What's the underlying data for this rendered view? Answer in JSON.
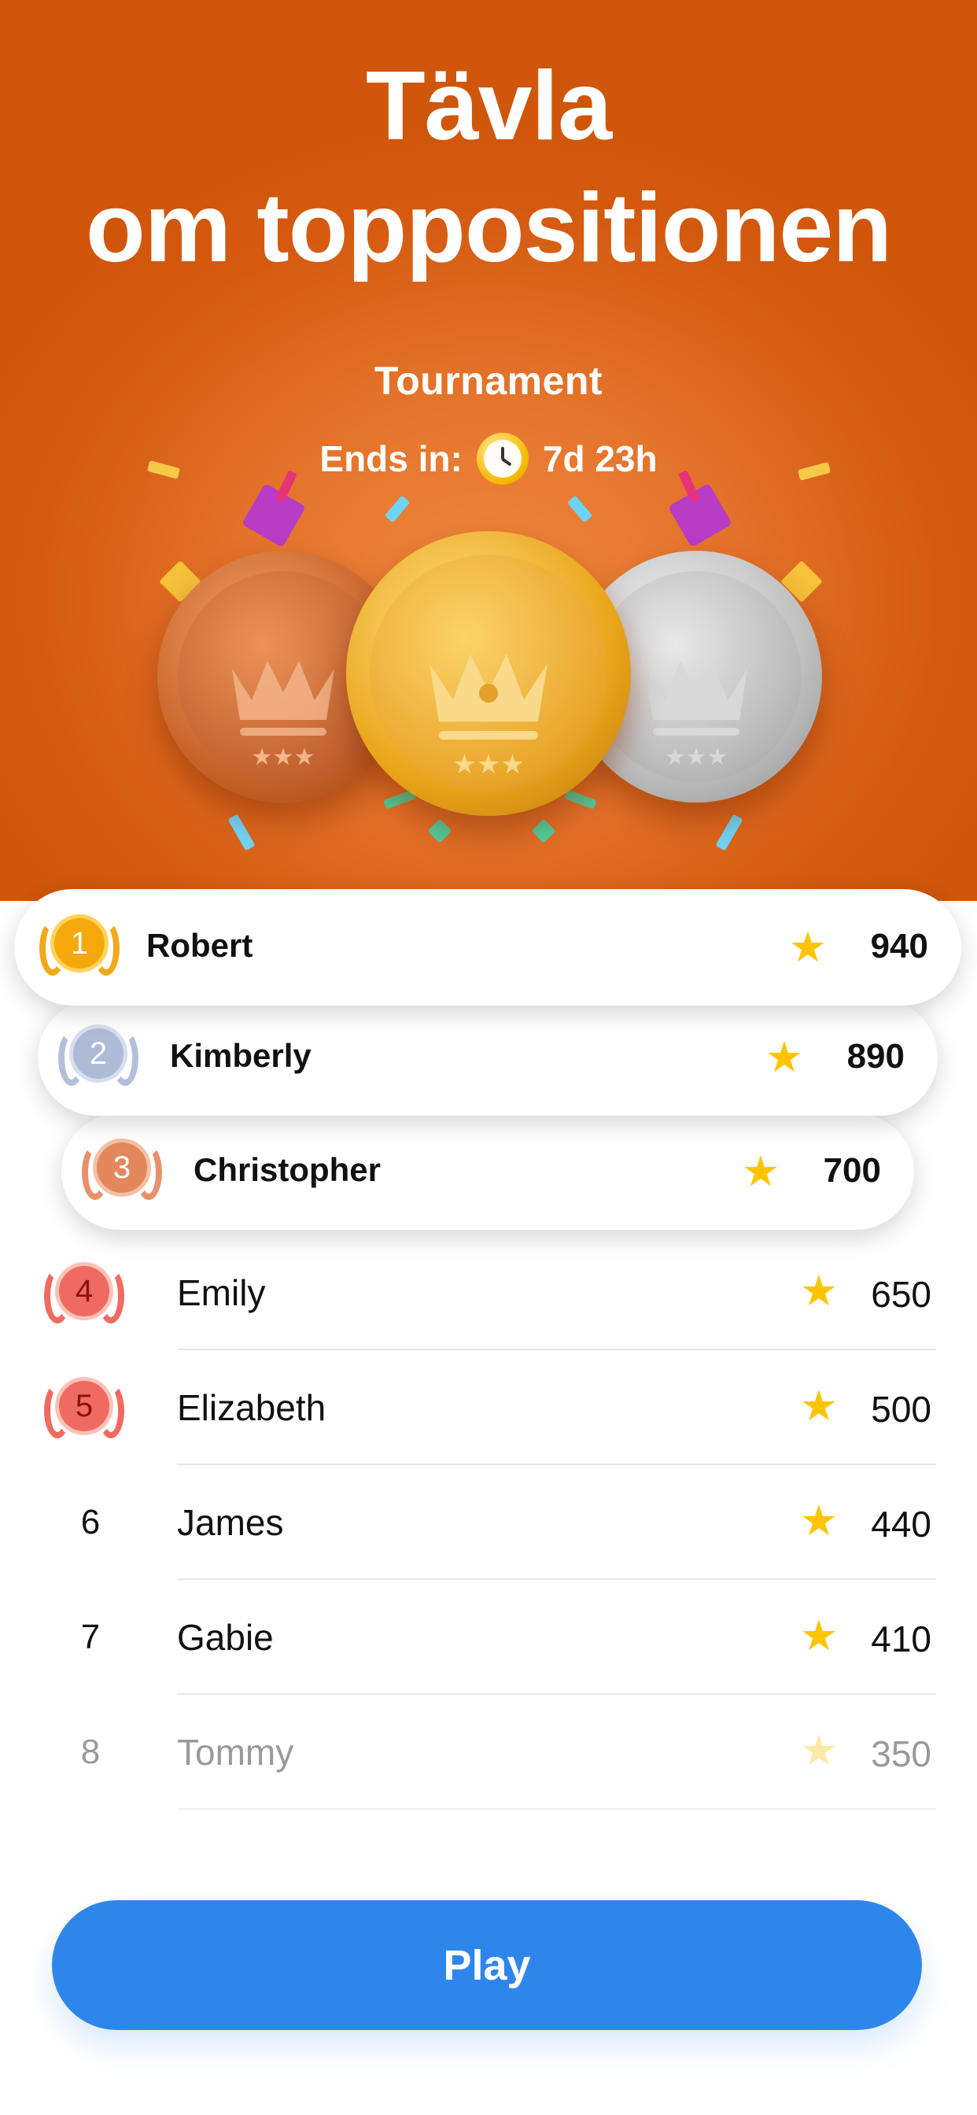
{
  "hero": {
    "headline_line1": "Tävla",
    "headline_line2": "om toppositionen",
    "tournament_label": "Tournament",
    "ends_in_label": "Ends in:",
    "ends_in_value": "7d 23h",
    "clock_icon": "clock-icon",
    "background_color": "#d45a10"
  },
  "leaderboard": {
    "top": [
      {
        "rank": "1",
        "name": "Robert",
        "score": "940",
        "medal": "gold"
      },
      {
        "rank": "2",
        "name": "Kimberly",
        "score": "890",
        "medal": "silver"
      },
      {
        "rank": "3",
        "name": "Christopher",
        "score": "700",
        "medal": "bronze"
      }
    ],
    "rows": [
      {
        "rank": "4",
        "name": "Emily",
        "score": "650",
        "badge": true
      },
      {
        "rank": "5",
        "name": "Elizabeth",
        "score": "500",
        "badge": true
      },
      {
        "rank": "6",
        "name": "James",
        "score": "440",
        "badge": false
      },
      {
        "rank": "7",
        "name": "Gabie",
        "score": "410",
        "badge": false
      },
      {
        "rank": "8",
        "name": "Tommy",
        "score": "350",
        "badge": false
      }
    ],
    "star_icon": "star-icon",
    "star_color": "#ffc400"
  },
  "play_button": {
    "label": "Play",
    "color": "#2f86ea"
  }
}
